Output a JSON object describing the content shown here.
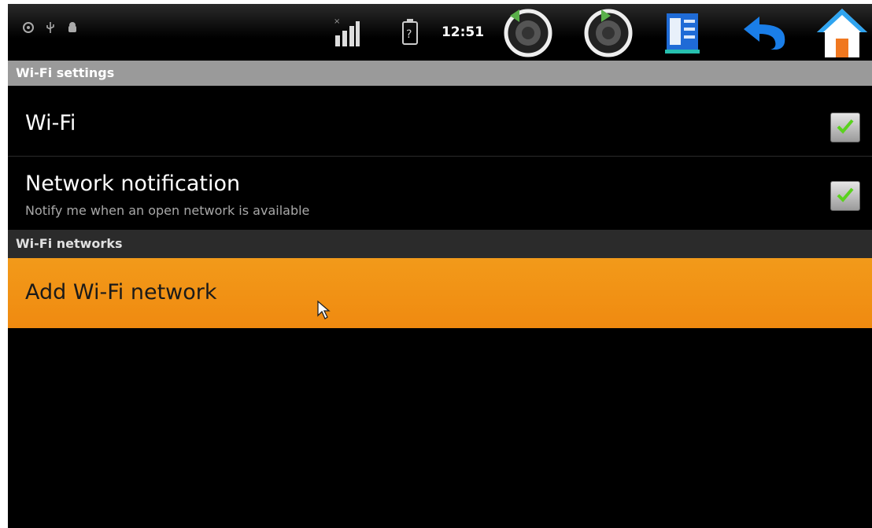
{
  "status_bar": {
    "time": "12:51",
    "icons": [
      "sync-icon",
      "usb-icon",
      "android-debug-icon",
      "signal-icon",
      "battery-unknown-icon",
      "volume-down-icon",
      "volume-up-icon",
      "menu-icon",
      "back-icon",
      "home-icon"
    ]
  },
  "sections": {
    "wifi_settings": "Wi-Fi settings",
    "wifi_networks": "Wi-Fi networks"
  },
  "wifi_toggle": {
    "title": "Wi-Fi",
    "checked": true
  },
  "network_notification": {
    "title": "Network notification",
    "subtitle": "Notify me when an open network is available",
    "checked": true
  },
  "add_network": {
    "label": "Add Wi-Fi network"
  },
  "colors": {
    "highlight": "#f0900f",
    "check": "#5ad21e",
    "header_bg": "#9a9a9a"
  }
}
